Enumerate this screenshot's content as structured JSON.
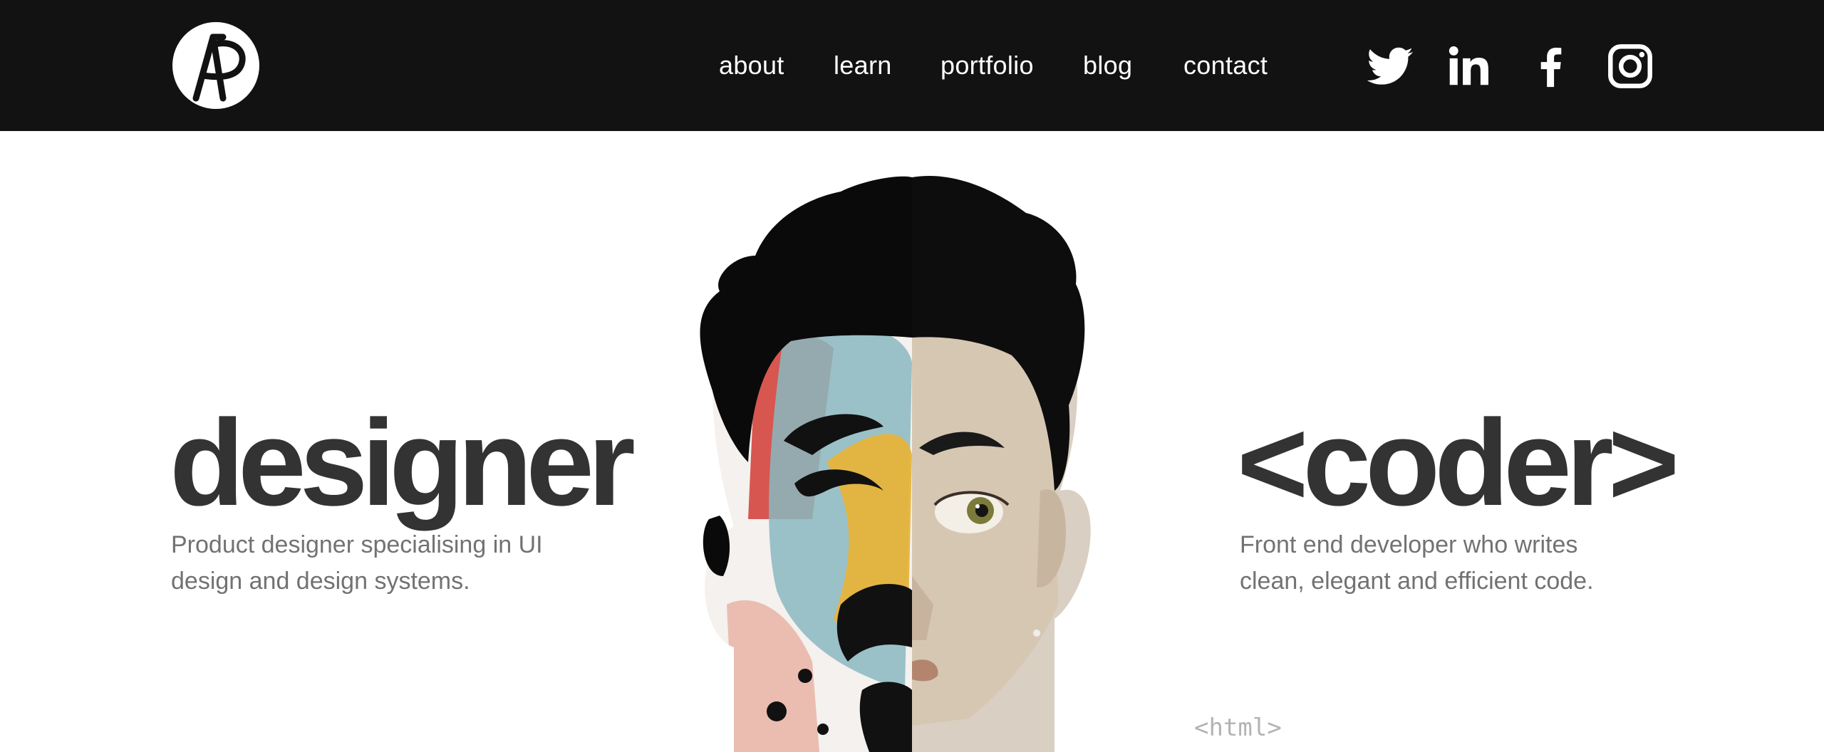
{
  "header": {
    "logo_alt": "AP",
    "nav": [
      {
        "label": "about"
      },
      {
        "label": "learn"
      },
      {
        "label": "portfolio"
      },
      {
        "label": "blog"
      },
      {
        "label": "contact"
      }
    ],
    "social": [
      {
        "icon": "twitter-icon"
      },
      {
        "icon": "linkedin-icon"
      },
      {
        "icon": "facebook-icon"
      },
      {
        "icon": "instagram-icon"
      }
    ]
  },
  "hero": {
    "designer": {
      "title": "designer",
      "description_line1": "Product designer specialising in UI",
      "description_line2": "design and design systems."
    },
    "coder": {
      "title": "<coder>",
      "description_line1": "Front end developer who writes",
      "description_line2": "clean, elegant and efficient code."
    },
    "code_decoration": "<html>"
  },
  "colors": {
    "header_bg": "#121212",
    "headline": "#333333",
    "body_text": "#727272",
    "accent_red": "#d5453e",
    "accent_teal": "#8ab8bf",
    "accent_yellow": "#e6b43c",
    "accent_pink": "#e9b7a8"
  }
}
